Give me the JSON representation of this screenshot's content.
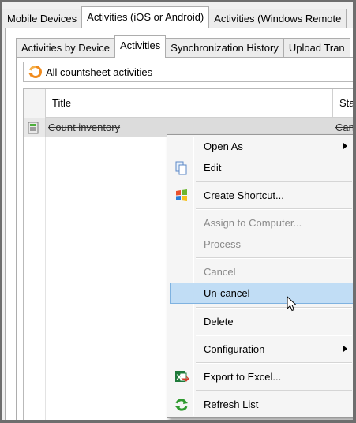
{
  "outer_tabs": [
    {
      "label": "Mobile Devices",
      "active": false
    },
    {
      "label": "Activities (iOS or Android)",
      "active": true
    },
    {
      "label": "Activities (Windows Remote",
      "active": false
    }
  ],
  "inner_tabs": [
    {
      "label": "Activities by Device",
      "active": false
    },
    {
      "label": "Activities",
      "active": true
    },
    {
      "label": "Synchronization History",
      "active": false
    },
    {
      "label": "Upload Tran",
      "active": false
    }
  ],
  "filter": {
    "label": "All countsheet activities",
    "icon": "refresh-orange-icon"
  },
  "grid": {
    "columns": [
      "Title",
      "Stat"
    ],
    "rows": [
      {
        "title": "Count inventory",
        "status": "Canc",
        "icon": "activity-icon"
      }
    ]
  },
  "context_menu": {
    "items": [
      {
        "label": "Open As",
        "disabled": false,
        "submenu": true,
        "icon": ""
      },
      {
        "label": "Edit",
        "disabled": false,
        "submenu": false,
        "icon": "edit-pages-icon"
      },
      {
        "label": "Create Shortcut...",
        "disabled": false,
        "submenu": false,
        "icon": "windows-flag-icon"
      },
      {
        "label": "Assign to Computer...",
        "disabled": true,
        "submenu": false,
        "icon": ""
      },
      {
        "label": "Process",
        "disabled": true,
        "submenu": false,
        "icon": ""
      },
      {
        "label": "Cancel",
        "disabled": true,
        "submenu": false,
        "icon": ""
      },
      {
        "label": "Un-cancel",
        "disabled": false,
        "submenu": false,
        "icon": "",
        "highlighted": true
      },
      {
        "label": "Delete",
        "disabled": false,
        "submenu": false,
        "icon": ""
      },
      {
        "label": "Configuration",
        "disabled": false,
        "submenu": true,
        "icon": ""
      },
      {
        "label": "Export to Excel...",
        "disabled": false,
        "submenu": false,
        "icon": "excel-icon"
      },
      {
        "label": "Refresh List",
        "disabled": false,
        "submenu": false,
        "icon": "refresh-green-icon"
      }
    ]
  },
  "colors": {
    "menu_highlight": "#c1ddf5",
    "selected_row": "#dcdcdc",
    "disabled_text": "#8a8a8a"
  }
}
